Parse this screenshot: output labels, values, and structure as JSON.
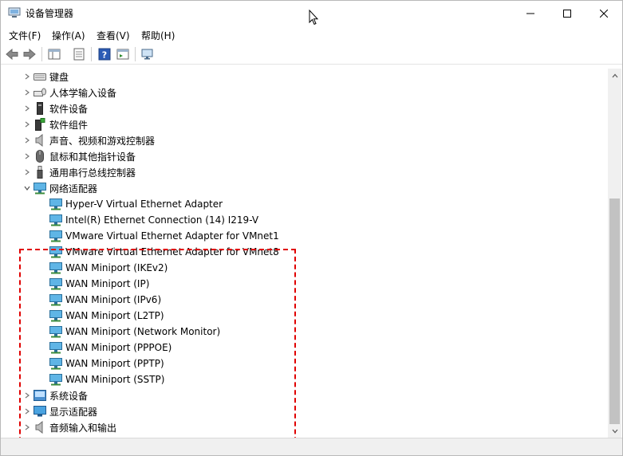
{
  "window": {
    "title": "设备管理器"
  },
  "menu": {
    "file": "文件(F)",
    "action": "操作(A)",
    "view": "查看(V)",
    "help": "帮助(H)"
  },
  "tree": {
    "keyboard": "键盘",
    "hid": "人体学输入设备",
    "software_devices": "软件设备",
    "software_components": "软件组件",
    "sound": "声音、视频和游戏控制器",
    "mice": "鼠标和其他指针设备",
    "usb": "通用串行总线控制器",
    "network": "网络适配器",
    "adapters": [
      "Hyper-V Virtual Ethernet Adapter",
      "Intel(R) Ethernet Connection (14) I219-V",
      "VMware Virtual Ethernet Adapter for VMnet1",
      "VMware Virtual Ethernet Adapter for VMnet8",
      "WAN Miniport (IKEv2)",
      "WAN Miniport (IP)",
      "WAN Miniport (IPv6)",
      "WAN Miniport (L2TP)",
      "WAN Miniport (Network Monitor)",
      "WAN Miniport (PPPOE)",
      "WAN Miniport (PPTP)",
      "WAN Miniport (SSTP)"
    ],
    "system": "系统设备",
    "display": "显示适配器",
    "audio_io": "音频输入和输出"
  },
  "icons": {
    "app": "device-manager-icon",
    "keyboard": "keyboard-icon",
    "hid": "hid-icon",
    "software_device": "software-device-icon",
    "software_component": "software-component-icon",
    "sound": "speaker-icon",
    "mouse": "mouse-icon",
    "usb": "usb-icon",
    "network": "network-adapter-icon",
    "system": "system-devices-icon",
    "display": "display-adapter-icon",
    "audio": "speaker-icon"
  },
  "colors": {
    "highlight": "#e00000"
  }
}
